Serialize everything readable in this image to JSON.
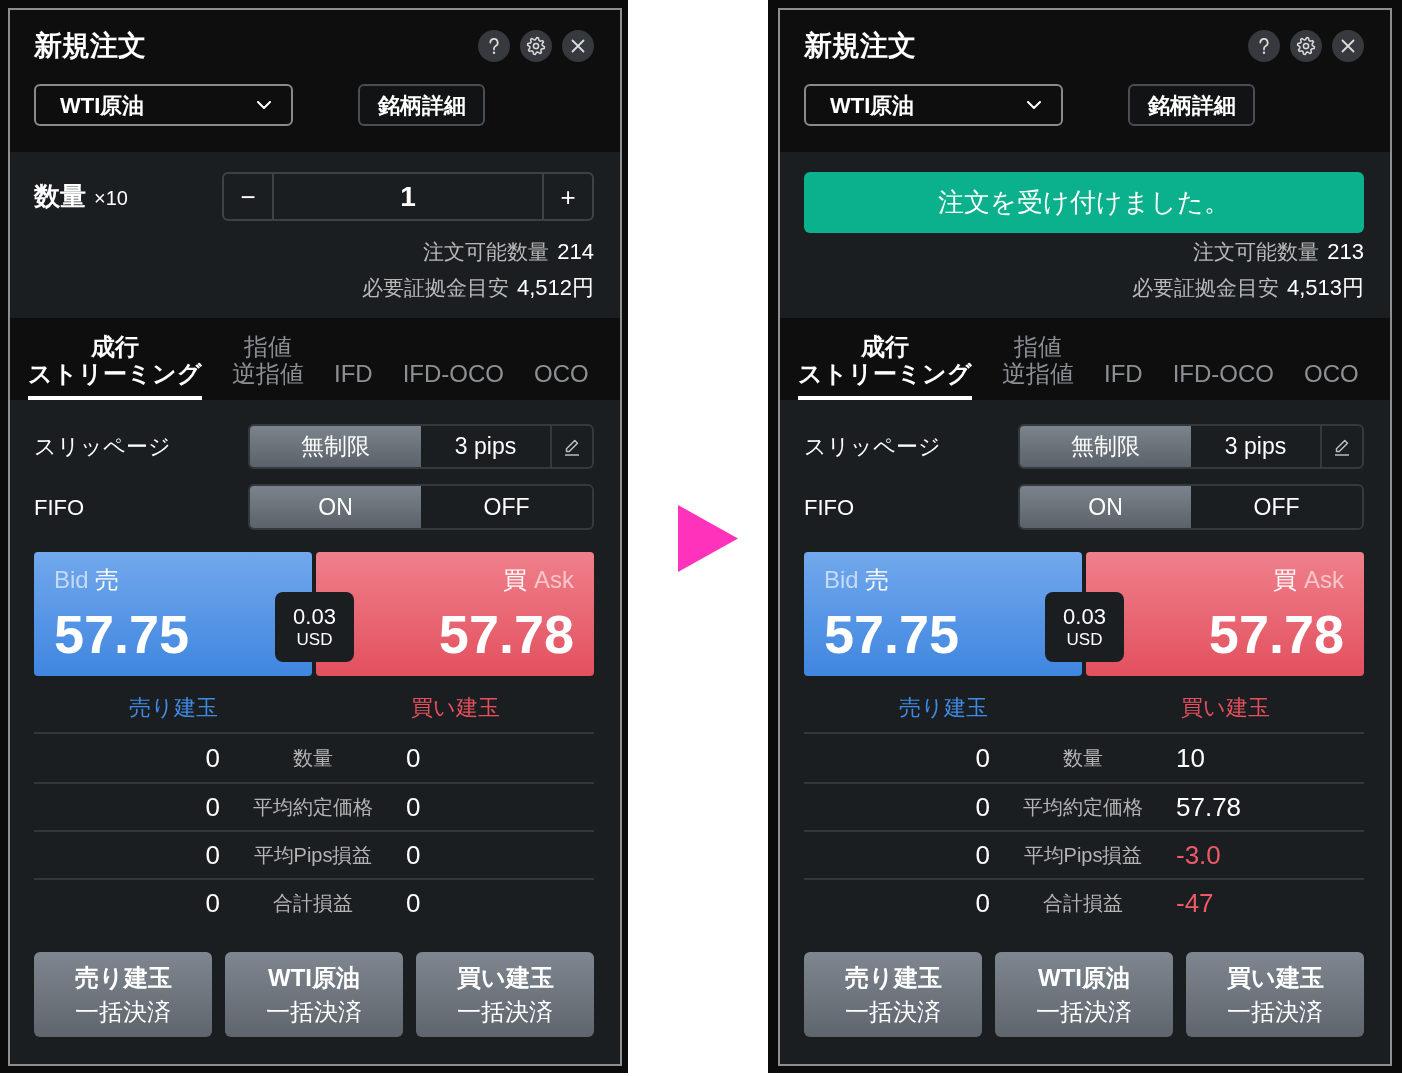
{
  "panels": [
    {
      "title": "新規注文",
      "symbol": "WTI原油",
      "detail_button": "銘柄詳細",
      "quantity": {
        "label": "数量",
        "multiplier": "×10",
        "minus": "−",
        "value": "1",
        "plus": "+"
      },
      "available": {
        "label": "注文可能数量",
        "value": "214"
      },
      "margin": {
        "label": "必要証拠金目安",
        "value": "4,512円"
      },
      "order_tabs": [
        {
          "lines": [
            "成行",
            "ストリーミング"
          ],
          "selected": true
        },
        {
          "lines": [
            "指値",
            "逆指値"
          ],
          "selected": false
        },
        {
          "lines": [
            "IFD"
          ],
          "selected": false
        },
        {
          "lines": [
            "IFD-OCO"
          ],
          "selected": false
        },
        {
          "lines": [
            "OCO"
          ],
          "selected": false
        }
      ],
      "slippage": {
        "label": "スリッページ",
        "options": [
          {
            "label": "無制限",
            "selected": true
          },
          {
            "label": "3 pips",
            "selected": false
          }
        ]
      },
      "fifo": {
        "label": "FIFO",
        "options": [
          {
            "label": "ON",
            "selected": true
          },
          {
            "label": "OFF",
            "selected": false
          }
        ]
      },
      "bid": {
        "label": "Bid",
        "side": "売",
        "price": "57.75"
      },
      "ask": {
        "side": "買",
        "label": "Ask",
        "price": "57.78"
      },
      "spread": {
        "value": "0.03",
        "unit": "USD"
      },
      "positions": {
        "sell_title": "売り建玉",
        "buy_title": "買い建玉",
        "rows": [
          {
            "sell": "0",
            "label": "数量",
            "buy": "0",
            "buy_loss": false
          },
          {
            "sell": "0",
            "label": "平均約定価格",
            "buy": "0",
            "buy_loss": false
          },
          {
            "sell": "0",
            "label": "平均Pips損益",
            "buy": "0",
            "buy_loss": false
          },
          {
            "sell": "0",
            "label": "合計損益",
            "buy": "0",
            "buy_loss": false
          }
        ]
      },
      "close_buttons": [
        {
          "lines": [
            "売り建玉",
            "一括決済"
          ]
        },
        {
          "lines": [
            "WTI原油",
            "一括決済"
          ]
        },
        {
          "lines": [
            "買い建玉",
            "一括決済"
          ]
        }
      ]
    },
    {
      "title": "新規注文",
      "symbol": "WTI原油",
      "detail_button": "銘柄詳細",
      "toast": "注文を受け付けました。",
      "available": {
        "label": "注文可能数量",
        "value": "213"
      },
      "margin": {
        "label": "必要証拠金目安",
        "value": "4,513円"
      },
      "order_tabs": [
        {
          "lines": [
            "成行",
            "ストリーミング"
          ],
          "selected": true
        },
        {
          "lines": [
            "指値",
            "逆指値"
          ],
          "selected": false
        },
        {
          "lines": [
            "IFD"
          ],
          "selected": false
        },
        {
          "lines": [
            "IFD-OCO"
          ],
          "selected": false
        },
        {
          "lines": [
            "OCO"
          ],
          "selected": false
        }
      ],
      "slippage": {
        "label": "スリッページ",
        "options": [
          {
            "label": "無制限",
            "selected": true
          },
          {
            "label": "3 pips",
            "selected": false
          }
        ]
      },
      "fifo": {
        "label": "FIFO",
        "options": [
          {
            "label": "ON",
            "selected": true
          },
          {
            "label": "OFF",
            "selected": false
          }
        ]
      },
      "bid": {
        "label": "Bid",
        "side": "売",
        "price": "57.75"
      },
      "ask": {
        "side": "買",
        "label": "Ask",
        "price": "57.78"
      },
      "spread": {
        "value": "0.03",
        "unit": "USD"
      },
      "positions": {
        "sell_title": "売り建玉",
        "buy_title": "買い建玉",
        "rows": [
          {
            "sell": "0",
            "label": "数量",
            "buy": "10",
            "buy_loss": false
          },
          {
            "sell": "0",
            "label": "平均約定価格",
            "buy": "57.78",
            "buy_loss": false
          },
          {
            "sell": "0",
            "label": "平均Pips損益",
            "buy": "-3.0",
            "buy_loss": true
          },
          {
            "sell": "0",
            "label": "合計損益",
            "buy": "-47",
            "buy_loss": true
          }
        ]
      },
      "close_buttons": [
        {
          "lines": [
            "売り建玉",
            "一括決済"
          ]
        },
        {
          "lines": [
            "WTI原油",
            "一括決済"
          ]
        },
        {
          "lines": [
            "買い建玉",
            "一括決済"
          ]
        }
      ]
    }
  ]
}
